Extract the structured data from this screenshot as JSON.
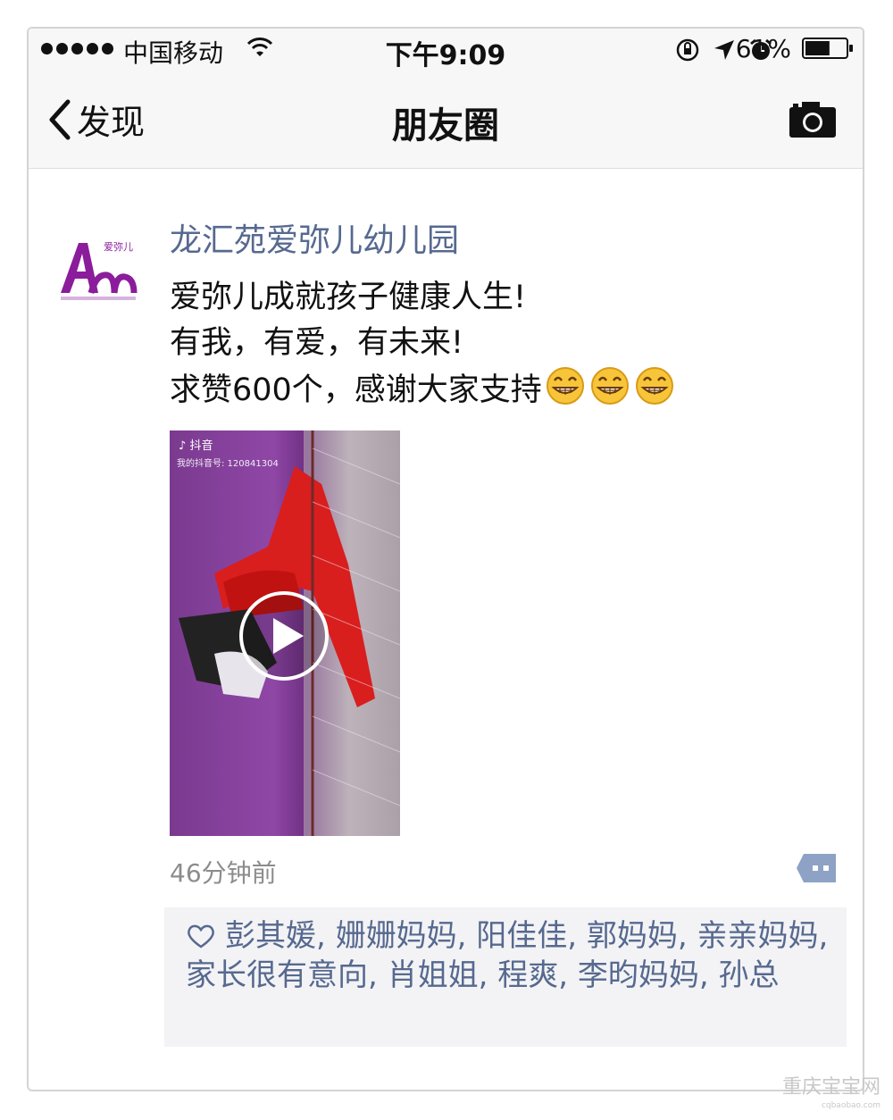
{
  "status_bar": {
    "carrier": "中国移动",
    "time": "下午9:09",
    "battery": "61%",
    "battery_level": 0.61
  },
  "nav": {
    "back_label": "发现",
    "title": "朋友圈"
  },
  "post": {
    "author": "龙汇苑爱弥儿幼儿园",
    "avatar_text": "爱弥儿",
    "lines": [
      "爱弥儿成就孩子健康人生!",
      "有我，有爱，有未来!",
      "求赞600个，感谢大家支持"
    ],
    "emoji": "grinning-face",
    "video": {
      "app_label": "抖音",
      "account": "我的抖音号: 120841304"
    },
    "time_ago": "46分钟前",
    "likes": "彭其媛, 姗姗妈妈, 阳佳佳, 郭妈妈, 亲亲妈妈, 家长很有意向, 肖姐姐, 程爽, 李昀妈妈, 孙总"
  },
  "watermark": {
    "name": "重庆宝宝网",
    "url": "cqbaobao.com"
  },
  "colors": {
    "link": "#56698f",
    "bar_bg": "#f7f7f7",
    "likes_bg": "#f3f3f5"
  }
}
